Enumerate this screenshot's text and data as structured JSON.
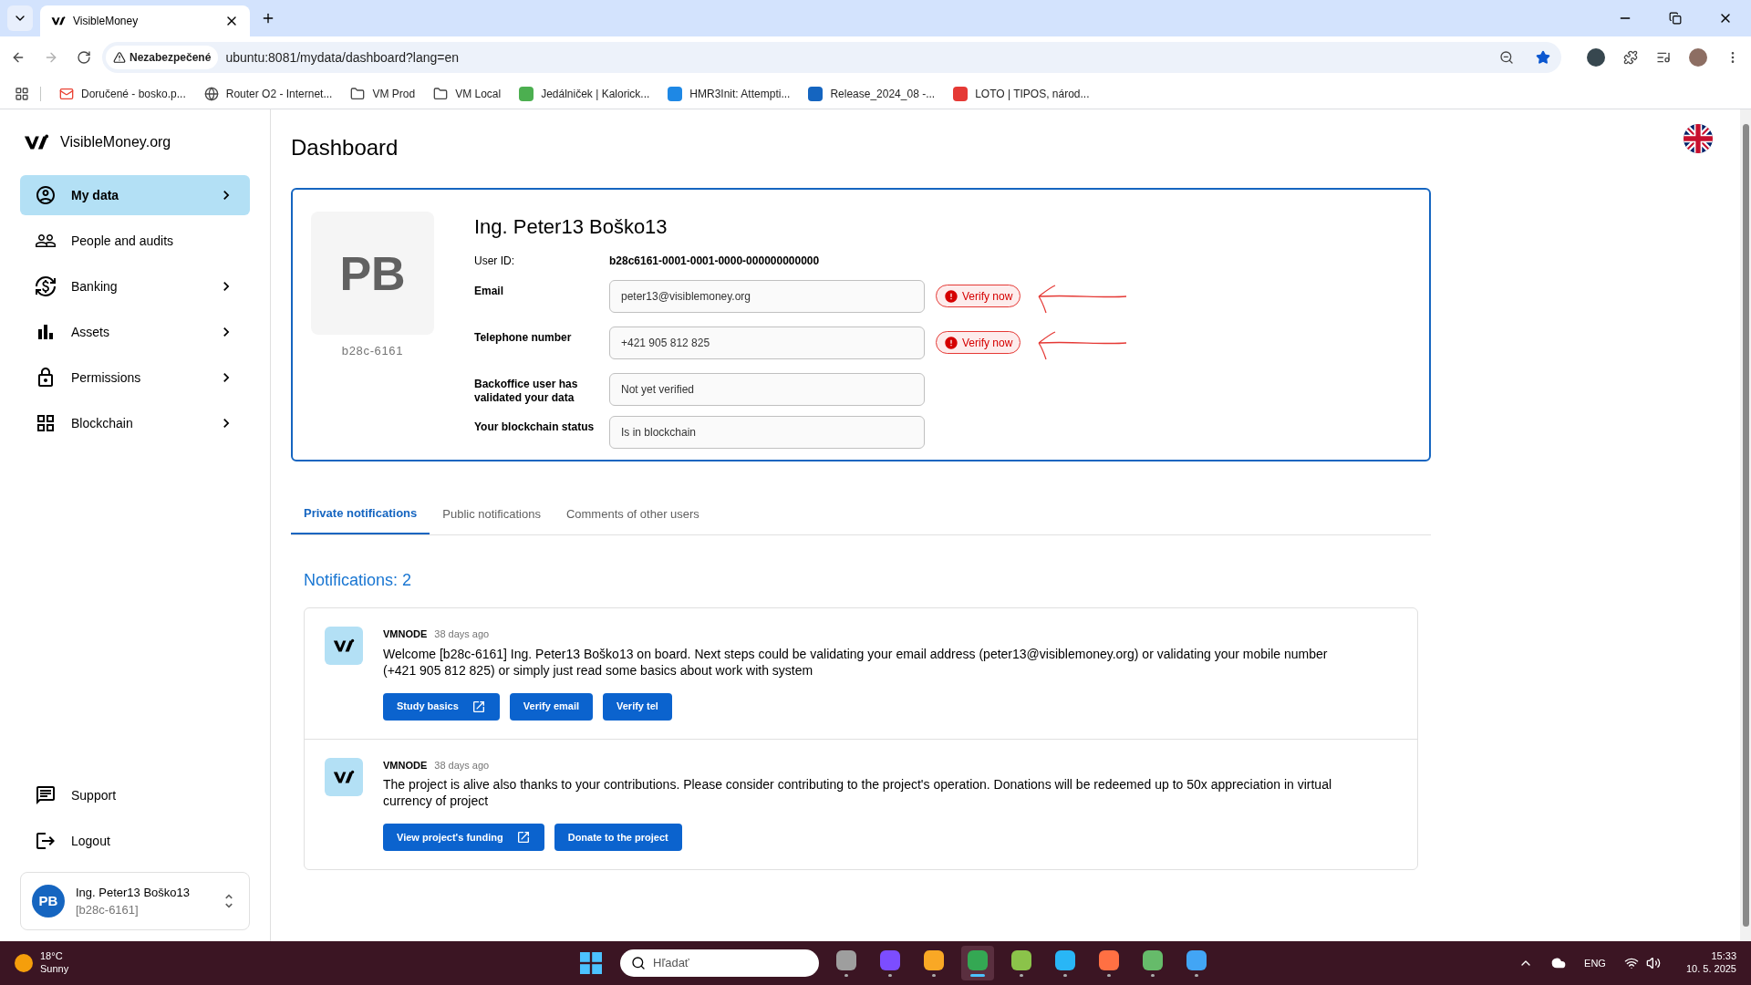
{
  "browser": {
    "tab_title": "VisibleMoney",
    "security_label": "Nezabezpečené",
    "url": "ubuntu:8081/mydata/dashboard?lang=en",
    "bookmarks": [
      {
        "label": "Doručené - bosko.p...",
        "kind": "mail",
        "color": "#ea4335"
      },
      {
        "label": "Router O2 - Internet...",
        "kind": "globe",
        "color": "#474747"
      },
      {
        "label": "VM Prod",
        "kind": "folder",
        "color": "#474747"
      },
      {
        "label": "VM Local",
        "kind": "folder",
        "color": "#474747"
      },
      {
        "label": "Jedálniček | Kalorick...",
        "kind": "app",
        "color": "#4caf50"
      },
      {
        "label": "HMR3Init: Attempti...",
        "kind": "app",
        "color": "#1e88e5"
      },
      {
        "label": "Release_2024_08 -...",
        "kind": "app",
        "color": "#1565c0"
      },
      {
        "label": "LOTO | TIPOS, národ...",
        "kind": "app",
        "color": "#e53935"
      }
    ]
  },
  "sidebar": {
    "brand": "VisibleMoney.org",
    "nav": [
      {
        "label": "My data",
        "selected": true,
        "has_submenu": true
      },
      {
        "label": "People and audits",
        "selected": false,
        "has_submenu": false
      },
      {
        "label": "Banking",
        "selected": false,
        "has_submenu": true
      },
      {
        "label": "Assets",
        "selected": false,
        "has_submenu": true
      },
      {
        "label": "Permissions",
        "selected": false,
        "has_submenu": true
      },
      {
        "label": "Blockchain",
        "selected": false,
        "has_submenu": true
      }
    ],
    "footer_nav": [
      {
        "label": "Support"
      },
      {
        "label": "Logout"
      }
    ],
    "user": {
      "initials": "PB",
      "name": "Ing. Peter13 Boško13",
      "id": "[b28c-6161]"
    }
  },
  "page": {
    "title": "Dashboard",
    "profile": {
      "initials": "PB",
      "short_id": "b28c-6161",
      "name": "Ing. Peter13 Boško13",
      "user_id_label": "User ID:",
      "user_id": "b28c6161-0001-0001-0000-000000000000",
      "fields": [
        {
          "label": "Email",
          "value": "peter13@visiblemoney.org",
          "verify_label": "Verify now",
          "annotated": true
        },
        {
          "label": "Telephone number",
          "value": "+421 905 812 825",
          "verify_label": "Verify now",
          "annotated": true
        },
        {
          "label": "Backoffice user has validated your data",
          "value": "Not yet verified",
          "annotated": false
        },
        {
          "label": "Your blockchain status",
          "value": "Is in blockchain",
          "annotated": false
        }
      ]
    },
    "tabs": [
      {
        "label": "Private notifications",
        "selected": true
      },
      {
        "label": "Public notifications",
        "selected": false
      },
      {
        "label": "Comments of other users",
        "selected": false
      }
    ],
    "notifications_title": "Notifications: 2",
    "notifications": [
      {
        "sender": "VMNODE",
        "time": "38 days ago",
        "message": "Welcome [b28c-6161] Ing. Peter13 Boško13 on board. Next steps could be validating your email address (peter13@visiblemoney.org) or validating your mobile number (+421 905 812 825) or simply just read some basics about work with system",
        "buttons": [
          {
            "label": "Study basics",
            "external": true
          },
          {
            "label": "Verify email",
            "external": false
          },
          {
            "label": "Verify tel",
            "external": false
          }
        ]
      },
      {
        "sender": "VMNODE",
        "time": "38 days ago",
        "message": "The project is alive also thanks to your contributions. Please consider contributing to the project's operation. Donations will be redeemed up to 50x appreciation in virtual currency of project",
        "buttons": [
          {
            "label": "View project's funding",
            "external": true
          },
          {
            "label": "Donate to the project",
            "external": false
          }
        ]
      }
    ]
  },
  "taskbar": {
    "temperature": "18°C",
    "condition": "Sunny",
    "search_placeholder": "Hľadať",
    "language": "ENG",
    "time": "15:33",
    "date": "10. 5. 2025",
    "apps": [
      {
        "color": "#9e9e9e",
        "selected": false
      },
      {
        "color": "#7c4dff",
        "selected": false
      },
      {
        "color": "#f9a825",
        "selected": false
      },
      {
        "color": "#34a853",
        "selected": true
      },
      {
        "color": "#8bc34a",
        "selected": false
      },
      {
        "color": "#29b6f6",
        "selected": false
      },
      {
        "color": "#ff7043",
        "selected": false
      },
      {
        "color": "#66bb6a",
        "selected": false
      },
      {
        "color": "#42a5f5",
        "selected": false
      }
    ]
  }
}
